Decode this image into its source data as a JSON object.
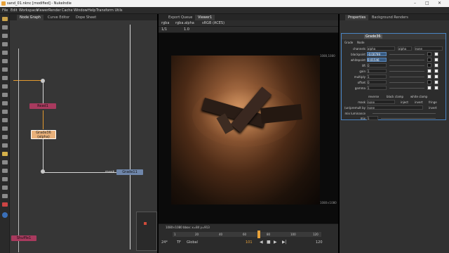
{
  "window": {
    "title": "sand_01.nknc [modified] - NukeIndie",
    "controls": [
      "–",
      "□",
      "✕"
    ]
  },
  "menu": [
    "File",
    "Edit",
    "Workspace",
    "Viewer",
    "Render",
    "Cache",
    "Window",
    "Help",
    "Transform Utils"
  ],
  "left_tabs": [
    "Node Graph",
    "Curve Editor",
    "Dope Sheet"
  ],
  "viewer_tabs": [
    "Export Queue",
    "Viewer1"
  ],
  "props_tabs": [
    "Properties",
    "Background Renders"
  ],
  "viewer_toolbar": {
    "channels": "rgba",
    "alpha": "rgba.alpha",
    "colorspace": "sRGB (ACES)",
    "zoom_label": "1/1",
    "frame_label": "1.0"
  },
  "viewer": {
    "format_top": "1080,1080",
    "format_bottom": "1080×1080",
    "status": "1080×1080  bbox: x=84 y=913"
  },
  "timeline": {
    "fps": "24*",
    "tf": "TF",
    "global": "Global",
    "ticks": [
      "1",
      "20",
      "40",
      "60",
      "80",
      "100",
      "120"
    ],
    "current_frame": "101",
    "playhead_fraction": 0.58,
    "end": "120"
  },
  "nodes": {
    "read": "Read1",
    "grade": "Grade36",
    "grade_sub": "(alpha)",
    "merge": "Grade11",
    "bottom": "Shuffle1",
    "pipe_label": "mask"
  },
  "properties": {
    "node_name": "Grade36",
    "subtabs": [
      "Grade",
      "Node"
    ],
    "rows": [
      {
        "label": "channels",
        "value": "alpha",
        "extra": "alpha",
        "extra2": "none"
      },
      {
        "label": "blackpoint",
        "value": "-0.00799"
      },
      {
        "label": "whitepoint",
        "value": "0.01546"
      },
      {
        "label": "lift",
        "value": "0"
      },
      {
        "label": "gain",
        "value": "1"
      },
      {
        "label": "multiply",
        "value": "1"
      },
      {
        "label": "offset",
        "value": "0"
      },
      {
        "label": "gamma",
        "value": "1"
      }
    ],
    "checks": [
      "reverse",
      "black clamp",
      "white clamp"
    ],
    "mask_label": "mask",
    "mask_value": "none",
    "mask_opts": [
      "inject",
      "invert",
      "fringe"
    ],
    "unpremult_label": "(un)premult by",
    "unpremult_value": "none",
    "unpremult_invert": "invert",
    "mix_lum_label": "mix luminance",
    "mix_label": "mix",
    "mix_value": "1"
  }
}
